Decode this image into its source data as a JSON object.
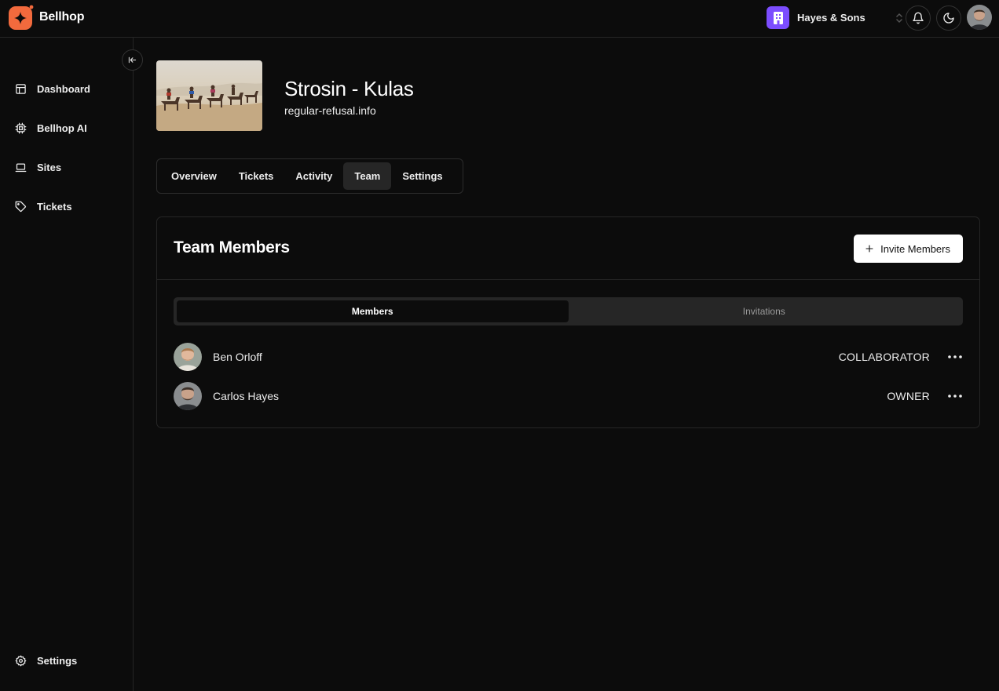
{
  "app": {
    "name": "Bellhop"
  },
  "header": {
    "org_name": "Hayes & Sons",
    "colors": {
      "org_accent": "#7c4dff",
      "brand": "#f26a3d"
    }
  },
  "sidebar": {
    "items": [
      {
        "label": "Dashboard",
        "icon": "layout-icon"
      },
      {
        "label": "Bellhop AI",
        "icon": "cpu-icon"
      },
      {
        "label": "Sites",
        "icon": "laptop-icon"
      },
      {
        "label": "Tickets",
        "icon": "tag-icon"
      }
    ],
    "footer_item": {
      "label": "Settings",
      "icon": "gear-icon"
    }
  },
  "site": {
    "title": "Strosin - Kulas",
    "domain": "regular-refusal.info"
  },
  "tabs": [
    {
      "label": "Overview",
      "active": false
    },
    {
      "label": "Tickets",
      "active": false
    },
    {
      "label": "Activity",
      "active": false
    },
    {
      "label": "Team",
      "active": true
    },
    {
      "label": "Settings",
      "active": false
    }
  ],
  "team": {
    "title": "Team Members",
    "invite_label": "Invite Members",
    "segments": [
      {
        "label": "Members",
        "active": true
      },
      {
        "label": "Invitations",
        "active": false
      }
    ],
    "members": [
      {
        "name": "Ben Orloff",
        "role": "COLLABORATOR"
      },
      {
        "name": "Carlos Hayes",
        "role": "OWNER"
      }
    ]
  }
}
